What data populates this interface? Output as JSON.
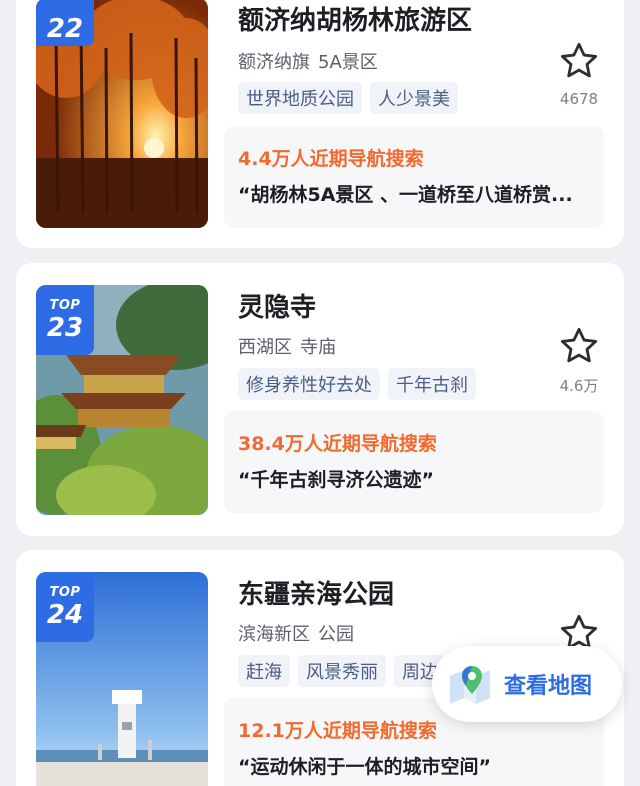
{
  "colors": {
    "accent": "#2e6ce6",
    "hot": "#f26a2e",
    "tag_bg": "#f0f3f8",
    "tag_text": "#4a5d86"
  },
  "items": [
    {
      "rank_label": "",
      "rank": "22",
      "name": "额济纳胡杨林旅游区",
      "district": "额济纳旗",
      "category": "5A景区",
      "tags": [
        "世界地质公园",
        "人少景美"
      ],
      "favorites": "4678",
      "search_heat": "4.4万人近期导航搜索",
      "quote": "“胡杨林5A景区 、一道桥至八道桥赏...",
      "image": "autumn-poplar-forest-sunset"
    },
    {
      "rank_label": "TOP",
      "rank": "23",
      "name": "灵隐寺",
      "district": "西湖区",
      "category": "寺庙",
      "tags": [
        "修身养性好去处",
        "千年古刹"
      ],
      "favorites": "4.6万",
      "search_heat": "38.4万人近期导航搜索",
      "quote": "“千年古刹寻济公遗迹”",
      "image": "temple-roofs-among-trees"
    },
    {
      "rank_label": "TOP",
      "rank": "24",
      "name": "东疆亲海公园",
      "district": "滨海新区",
      "category": "公园",
      "tags": [
        "赶海",
        "风景秀丽",
        "周边"
      ],
      "favorites": "",
      "search_heat": "12.1万人近期导航搜索",
      "quote": "“运动休闲于一体的城市空间”",
      "image": "seaside-lighthouse-blue-sky"
    }
  ],
  "map_button": {
    "label": "查看地图",
    "icon": "map-pin-icon"
  }
}
